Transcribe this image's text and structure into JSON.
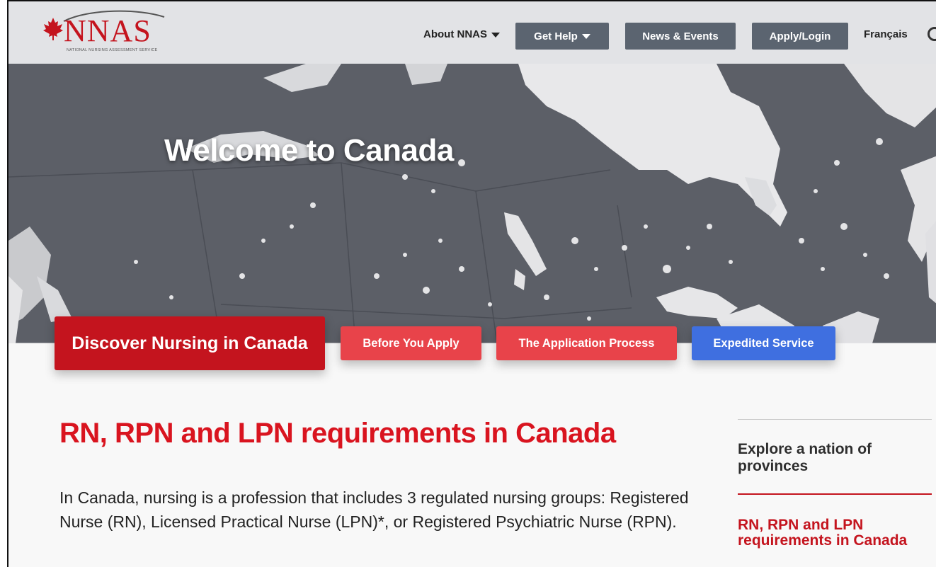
{
  "header": {
    "logo_text": "NNAS",
    "logo_tagline": "NATIONAL NURSING ASSESSMENT SERVICE",
    "nav": {
      "about": "About NNAS",
      "get_help": "Get Help",
      "news": "News & Events",
      "apply": "Apply/Login",
      "language": "Français"
    }
  },
  "hero": {
    "title": "Welcome to Canada"
  },
  "tabs": {
    "discover": "Discover Nursing in Canada",
    "before": "Before You Apply",
    "process": "The Application Process",
    "expedited": "Expedited Service"
  },
  "main": {
    "heading": "RN, RPN and LPN requirements in Canada",
    "paragraph": "In Canada, nursing is a profession that includes 3 regulated nursing groups: Registered Nurse (RN), Licensed Practical Nurse (LPN)*, or Registered Psychiatric Nurse (RPN)."
  },
  "sidebar": {
    "item1": "Explore a nation of provinces",
    "item2": "RN, RPN and LPN requirements in Canada"
  },
  "colors": {
    "brand_red": "#c4141e",
    "tab_red": "#e8434a",
    "tab_blue": "#3f6fe0",
    "nav_button": "#5b6470",
    "hero_bg": "#5c5f67"
  }
}
